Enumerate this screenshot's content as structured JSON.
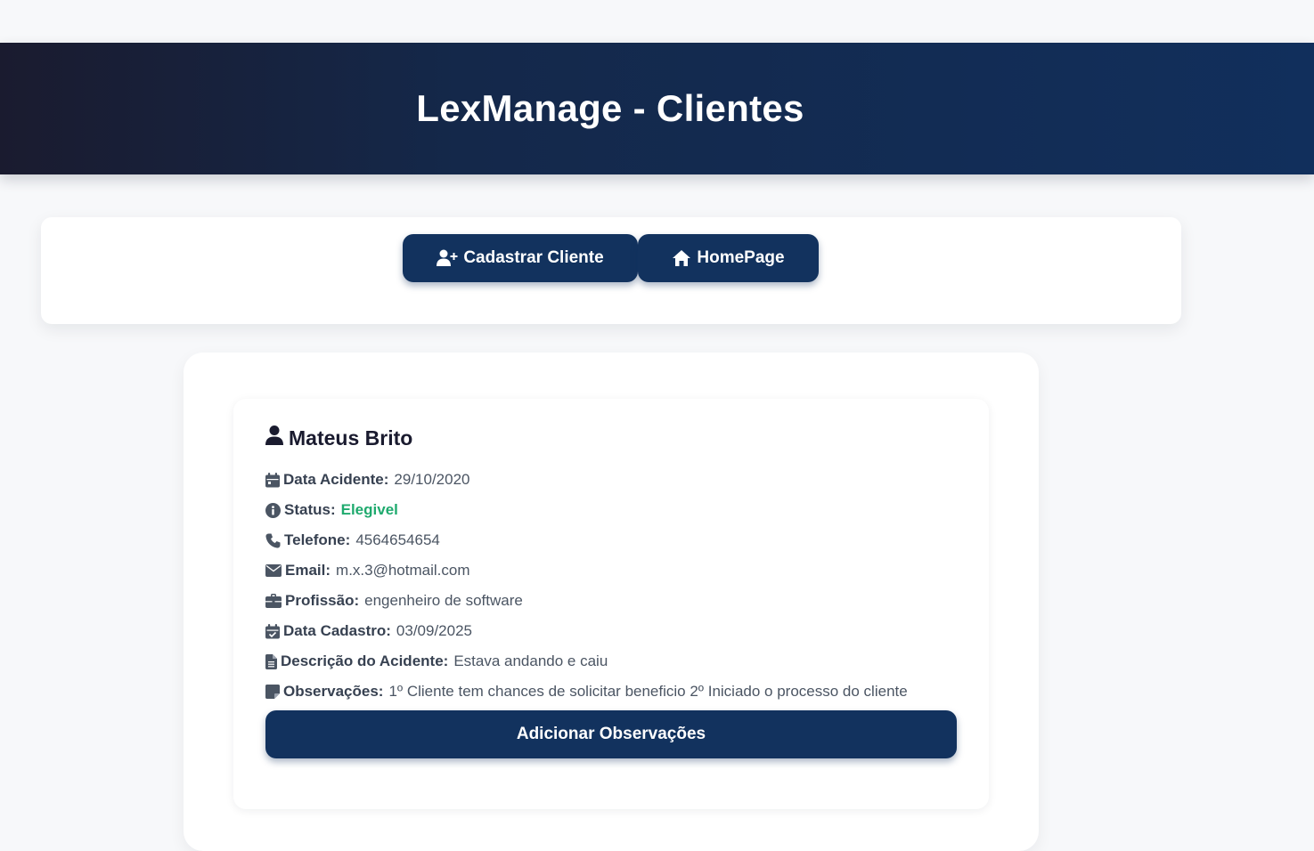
{
  "header": {
    "title": "LexManage - Clientes"
  },
  "toolbar": {
    "register_label": "Cadastrar Cliente",
    "home_label": "HomePage"
  },
  "client": {
    "name": "Mateus Brito",
    "fields": [
      {
        "icon": "calendar-icon",
        "label": "Data Acidente:",
        "value": "29/10/2020"
      },
      {
        "icon": "info-icon",
        "label": "Status:",
        "value": "Elegivel"
      },
      {
        "icon": "phone-icon",
        "label": "Telefone:",
        "value": "4564654654"
      },
      {
        "icon": "envelope-icon",
        "label": "Email:",
        "value": "m.x.3@hotmail.com"
      },
      {
        "icon": "briefcase-icon",
        "label": "Profissão:",
        "value": "engenheiro de software"
      },
      {
        "icon": "calendar-check-icon",
        "label": "Data Cadastro:",
        "value": "03/09/2025"
      },
      {
        "icon": "file-icon",
        "label": "Descrição do Acidente:",
        "value": "Estava andando e caiu"
      },
      {
        "icon": "sticky-note-icon",
        "label": "Observações:",
        "value": "1º Cliente tem chances de solicitar beneficio 2º Iniciado o processo do cliente"
      }
    ],
    "add_notes_label": "Adicionar Observações"
  },
  "colors": {
    "primary": "#12325e",
    "header_dark": "#1a1b2f",
    "status_ok": "#1faa6e"
  }
}
